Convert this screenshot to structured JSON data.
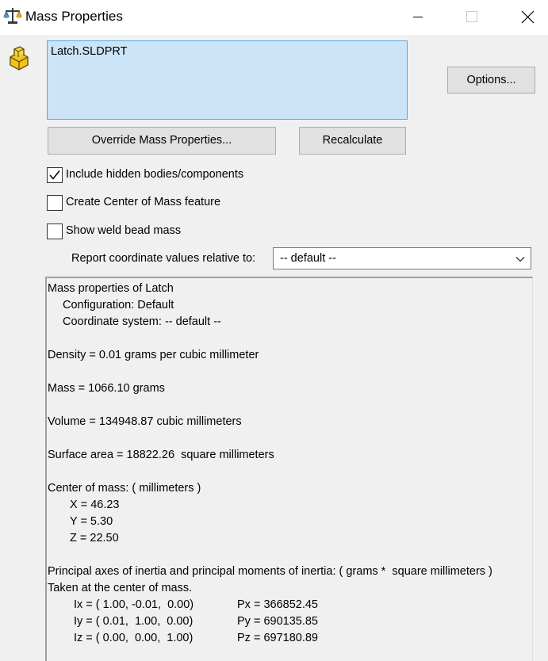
{
  "window": {
    "title": "Mass Properties",
    "icon": "balance-scale-icon",
    "controls": [
      "minimize-icon",
      "maximize-icon",
      "close-icon"
    ]
  },
  "selection": {
    "icon": "part-icon",
    "items": [
      "Latch.SLDPRT"
    ]
  },
  "buttons": {
    "options": "Options...",
    "override": "Override Mass Properties...",
    "recalculate": "Recalculate"
  },
  "checkboxes": [
    {
      "label": "Include hidden bodies/components",
      "checked": true
    },
    {
      "label": "Create Center of Mass feature",
      "checked": false
    },
    {
      "label": "Show weld bead mass",
      "checked": false
    }
  ],
  "coordinates": {
    "label": "Report coordinate values relative to:",
    "selected": "-- default --"
  },
  "results": {
    "heading": "Mass properties of Latch",
    "configuration": "Configuration: Default",
    "coordinate_system": "Coordinate system: -- default --",
    "density": "Density = 0.01 grams per cubic millimeter",
    "mass": "Mass = 1066.10 grams",
    "volume": "Volume = 134948.87 cubic millimeters",
    "surface_area": "Surface area = 18822.26  square millimeters",
    "center_heading": "Center of mass: ( millimeters )",
    "center_x": "X = 46.23",
    "center_y": "Y = 5.30",
    "center_z": "Z = 22.50",
    "axes_heading": "Principal axes of inertia and principal moments of inertia: ( grams *  square millimeters )",
    "axes_taken": "Taken at the center of mass.",
    "ix": "Ix = ( 1.00, -0.01,  0.00)",
    "iy": "Iy = ( 0.01,  1.00,  0.00)",
    "iz": "Iz = ( 0.00,  0.00,  1.00)",
    "px": "Px = 366852.45",
    "py": "Py = 690135.85",
    "pz": "Pz = 697180.89"
  },
  "colors": {
    "selection_bg": "#cce4f7",
    "selection_border": "#5aa8e0",
    "window_bg": "#f0f0f0",
    "button_bg": "#e1e1e1",
    "part_icon": "#f2c51e"
  }
}
